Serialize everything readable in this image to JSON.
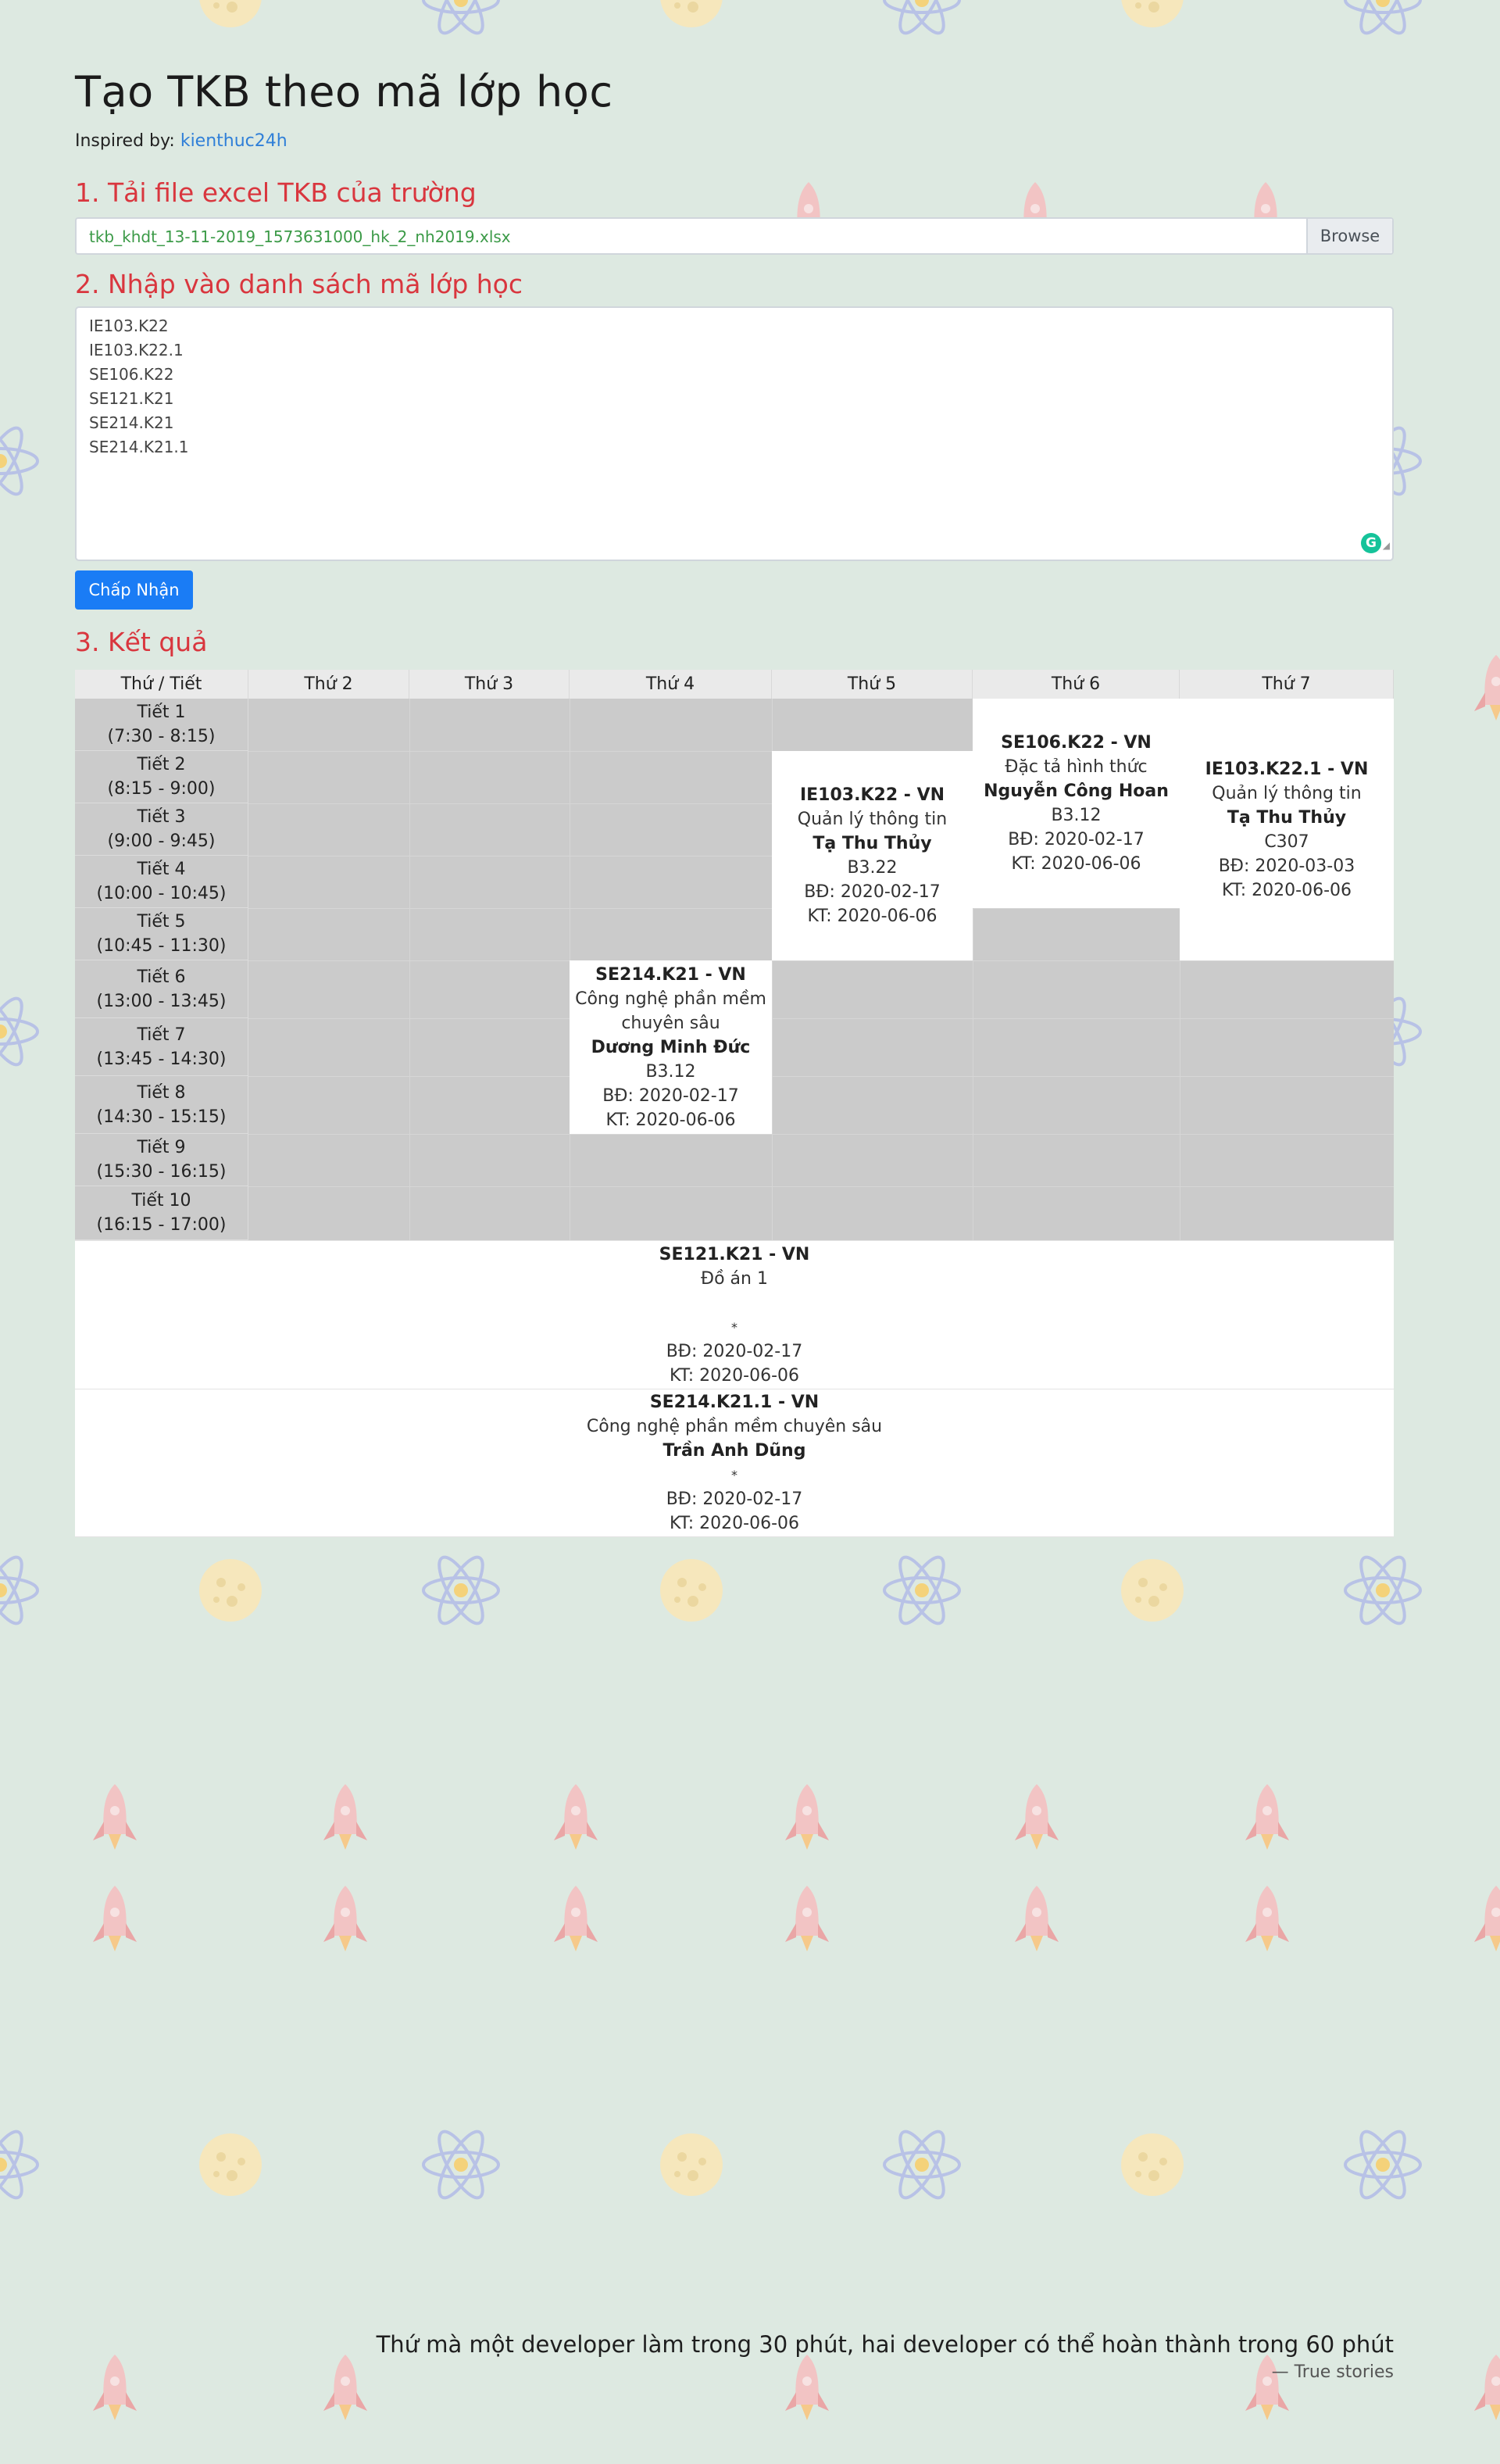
{
  "page": {
    "title": "Tạo TKB theo mã lớp học",
    "inspired_prefix": "Inspired by: ",
    "inspired_link": "kienthuc24h"
  },
  "step1": {
    "heading": "1. Tải file excel TKB của trường",
    "file_name": "tkb_khdt_13-11-2019_1573631000_hk_2_nh2019.xlsx",
    "browse_label": "Browse"
  },
  "step2": {
    "heading": "2. Nhập vào danh sách mã lớp học",
    "codes": [
      "IE103.K22",
      "IE103.K22.1",
      "SE106.K22",
      "SE121.K21",
      "SE214.K21",
      "SE214.K21.1"
    ],
    "grammarly_icon": "G",
    "accept_label": "Chấp Nhận"
  },
  "step3": {
    "heading": "3. Kết quả",
    "header_first": "Thứ / Tiết",
    "days": [
      "Thứ 2",
      "Thứ 3",
      "Thứ 4",
      "Thứ 5",
      "Thứ 6",
      "Thứ 7"
    ],
    "periods": [
      {
        "name": "Tiết 1",
        "time": "(7:30 - 8:15)"
      },
      {
        "name": "Tiết 2",
        "time": "(8:15 - 9:00)"
      },
      {
        "name": "Tiết 3",
        "time": "(9:00 - 9:45)"
      },
      {
        "name": "Tiết 4",
        "time": "(10:00 - 10:45)"
      },
      {
        "name": "Tiết 5",
        "time": "(10:45 - 11:30)"
      },
      {
        "name": "Tiết 6",
        "time": "(13:00 - 13:45)"
      },
      {
        "name": "Tiết 7",
        "time": "(13:45 - 14:30)"
      },
      {
        "name": "Tiết 8",
        "time": "(14:30 - 15:15)"
      },
      {
        "name": "Tiết 9",
        "time": "(15:30 - 16:15)"
      },
      {
        "name": "Tiết 10",
        "time": "(16:15 - 17:00)"
      }
    ],
    "courses": [
      {
        "code": "SE214.K21 - VN",
        "name_lines": [
          "Công nghệ phần mềm",
          "chuyên sâu"
        ],
        "teacher": "Dương Minh Đức",
        "room": "B3.12",
        "start": "BĐ: 2020-02-17",
        "end": "KT: 2020-06-06",
        "day_index": 2,
        "period_from": 6,
        "period_to": 8
      },
      {
        "code": "IE103.K22 - VN",
        "name_lines": [
          "Quản lý thông tin"
        ],
        "teacher": "Tạ Thu Thủy",
        "room": "B3.22",
        "start": "BĐ: 2020-02-17",
        "end": "KT: 2020-06-06",
        "day_index": 3,
        "period_from": 2,
        "period_to": 5
      },
      {
        "code": "SE106.K22 - VN",
        "name_lines": [
          "Đặc tả hình thức"
        ],
        "teacher": "Nguyễn Công Hoan",
        "room": "B3.12",
        "start": "BĐ: 2020-02-17",
        "end": "KT: 2020-06-06",
        "day_index": 4,
        "period_from": 1,
        "period_to": 4
      },
      {
        "code": "IE103.K22.1 - VN",
        "name_lines": [
          "Quản lý thông tin"
        ],
        "teacher": "Tạ Thu Thủy",
        "room": "C307",
        "start": "BĐ: 2020-03-03",
        "end": "KT: 2020-06-06",
        "day_index": 5,
        "period_from": 1,
        "period_to": 5
      }
    ],
    "extra_courses": [
      {
        "code": "SE121.K21 - VN",
        "name": "Đồ án 1",
        "teacher": "",
        "marker": "*",
        "start": "BĐ: 2020-02-17",
        "end": "KT: 2020-06-06"
      },
      {
        "code": "SE214.K21.1 - VN",
        "name": "Công nghệ phần mềm chuyên sâu",
        "teacher": "Trần Anh Dũng",
        "marker": "*",
        "start": "BĐ: 2020-02-17",
        "end": "KT: 2020-06-06"
      }
    ]
  },
  "footer": {
    "quote": "Thứ mà một developer làm trong 30 phút, hai developer có thể hoàn thành trong 60 phút",
    "source": "— True stories"
  },
  "colors": {
    "background": "#dde9e1",
    "heading_red": "#d9363e",
    "button_blue": "#1a7cf5",
    "link_blue": "#2f7fd8",
    "file_green": "#3b9a47",
    "empty_cell": "#cbcbcb"
  }
}
